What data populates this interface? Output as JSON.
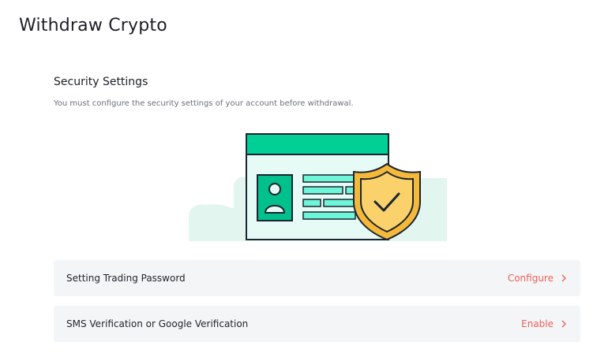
{
  "page": {
    "title": "Withdraw Crypto"
  },
  "security": {
    "title": "Security Settings",
    "description": "You must configure the security settings of your account before withdrawal."
  },
  "options": [
    {
      "label": "Setting Trading Password",
      "action": "Configure"
    },
    {
      "label": "SMS Verification or Google Verification",
      "action": "Enable"
    }
  ],
  "icons": {
    "illustration": "security-id-card-shield-illustration",
    "row_action": "chevron-right-icon"
  },
  "colors": {
    "accent_green": "#00cf96",
    "light_teal": "#6ef6d8",
    "shield_gold": "#fbd16b",
    "action_red": "#e8625a",
    "row_bg": "#f4f5f7"
  }
}
